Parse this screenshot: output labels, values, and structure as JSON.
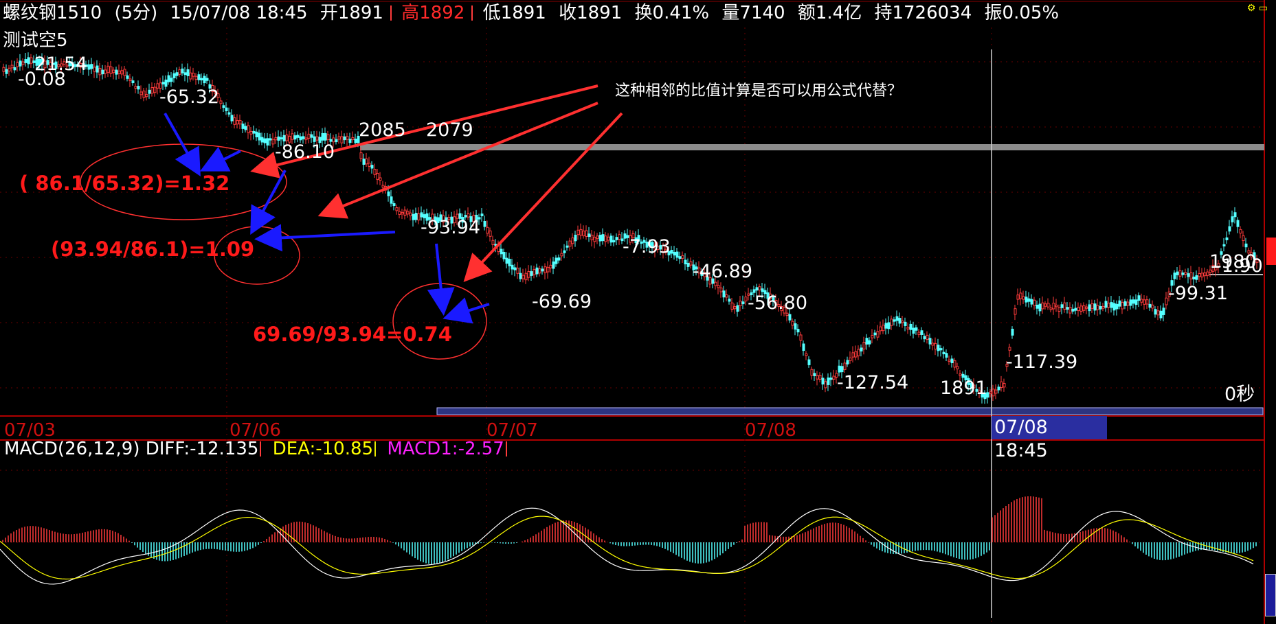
{
  "header": {
    "symbol": "螺纹钢1510",
    "period": "(5分)",
    "datetime": "15/07/08 18:45",
    "open": "开1891",
    "high": "高1892",
    "low": "低1891",
    "close": "收1891",
    "turnover_rate": "换0.41%",
    "volume": "量7140",
    "amount": "额1.4亿",
    "open_interest": "持1726034",
    "amplitude": "振0.05%"
  },
  "indicator_name": "测试空5",
  "dates": [
    "07/03",
    "07/06",
    "07/07",
    "07/08"
  ],
  "current_datetime": "07/08 18:45",
  "macd": {
    "title": "MACD(26,12,9)",
    "diff": "DIFF:-12.135",
    "dea": "DEA:-10.85",
    "macd1": "MACD1:-2.57"
  },
  "price_labels": [
    "21.54",
    "-0.08",
    "-65.32",
    "-86.10",
    "2085",
    "2079",
    "-93.94",
    "-69.69",
    "-7.93",
    "-46.89",
    "-56.80",
    "-127.54",
    "1891",
    "-117.39",
    "-99.31",
    "1980",
    "-1.90",
    "0秒"
  ],
  "annotations": {
    "question": "这种相邻的比值计算是否可以用公式代替？",
    "ratio1": "( 86.1/65.32)=1.32",
    "ratio2": "(93.94/86.1)=1.09",
    "ratio3": "69.69/93.94=0.74"
  },
  "colors": {
    "background": "#000000",
    "up_candle": "#ff3b3b",
    "down_candle": "#54ffff",
    "annotation_red": "#ff1a1a",
    "arrow_blue": "#1a1aff",
    "dea_line": "#ffff00",
    "macd1_text": "#ff22ff",
    "date_red": "#d01010",
    "highlight_blue": "#2a2ea0"
  }
}
